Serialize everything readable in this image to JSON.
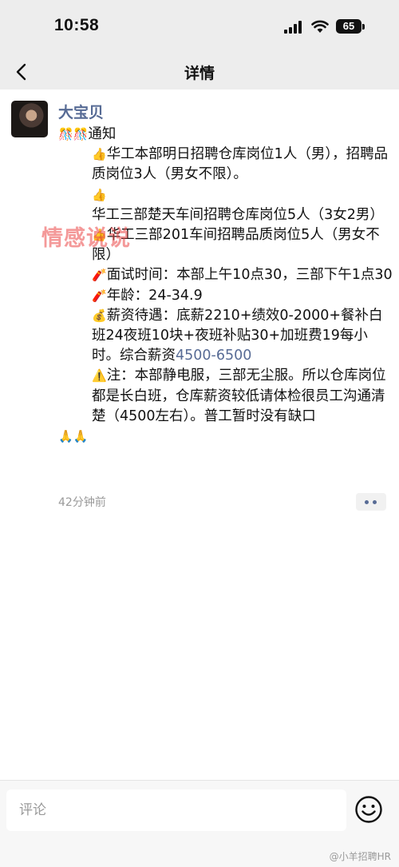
{
  "status_bar": {
    "time": "10:58",
    "battery": "65"
  },
  "nav": {
    "title": "详情"
  },
  "post": {
    "author": "大宝贝",
    "lines": [
      {
        "emoji": "🎊🎊",
        "text": "通知"
      },
      {
        "emoji": "👍",
        "text": "华工本部明日招聘仓库岗位1人（男），招聘品质岗位3人（男女不限）。"
      },
      {
        "emoji": "👍",
        "text": "华工三部楚天车间招聘仓库岗位5人（3女2男）"
      },
      {
        "emoji": "👍",
        "text": "华工三部201车间招聘品质岗位5人（男女不限）"
      },
      {
        "emoji": "🧨",
        "text": "面试时间：本部上午10点30，三部下午1点30"
      },
      {
        "emoji": "🧨",
        "text": "年龄：24-34.9"
      },
      {
        "emoji": "💰",
        "text": "薪资待遇：底薪2210+绩效0-2000+餐补白班24夜班10块+夜班补贴30+加班费19每小时。综合薪资"
      },
      {
        "emoji": "⚠️",
        "text": "注：本部静电服，三部无尘服。所以仓库岗位都是长白班，仓库薪资较低请体检很员工沟通清楚（4500左右）。普工暂时没有缺口"
      }
    ],
    "salary_highlight": "4500-6500",
    "ending_emoji": "🙏🙏",
    "timestamp": "42分钟前",
    "watermark": "情感说说"
  },
  "comment": {
    "placeholder": "评论"
  },
  "credit": "@小羊招聘HR"
}
